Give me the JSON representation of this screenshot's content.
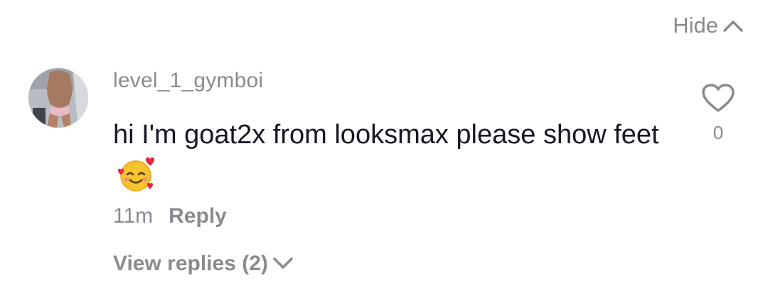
{
  "header": {
    "hide_label": "Hide"
  },
  "comment": {
    "username": "level_1_gymboi",
    "text": "hi I'm goat2x from looksmax please show feet",
    "emoji": "smiling-face-with-hearts",
    "timestamp": "11m",
    "reply_label": "Reply",
    "like_count": "0",
    "view_replies_label": "View replies (2)"
  },
  "colors": {
    "secondary_text": "#8a8b91",
    "primary_text": "#161823"
  },
  "icons": {
    "hide": "chevron-up-icon",
    "like": "heart-outline-icon",
    "view_replies": "chevron-down-icon"
  }
}
